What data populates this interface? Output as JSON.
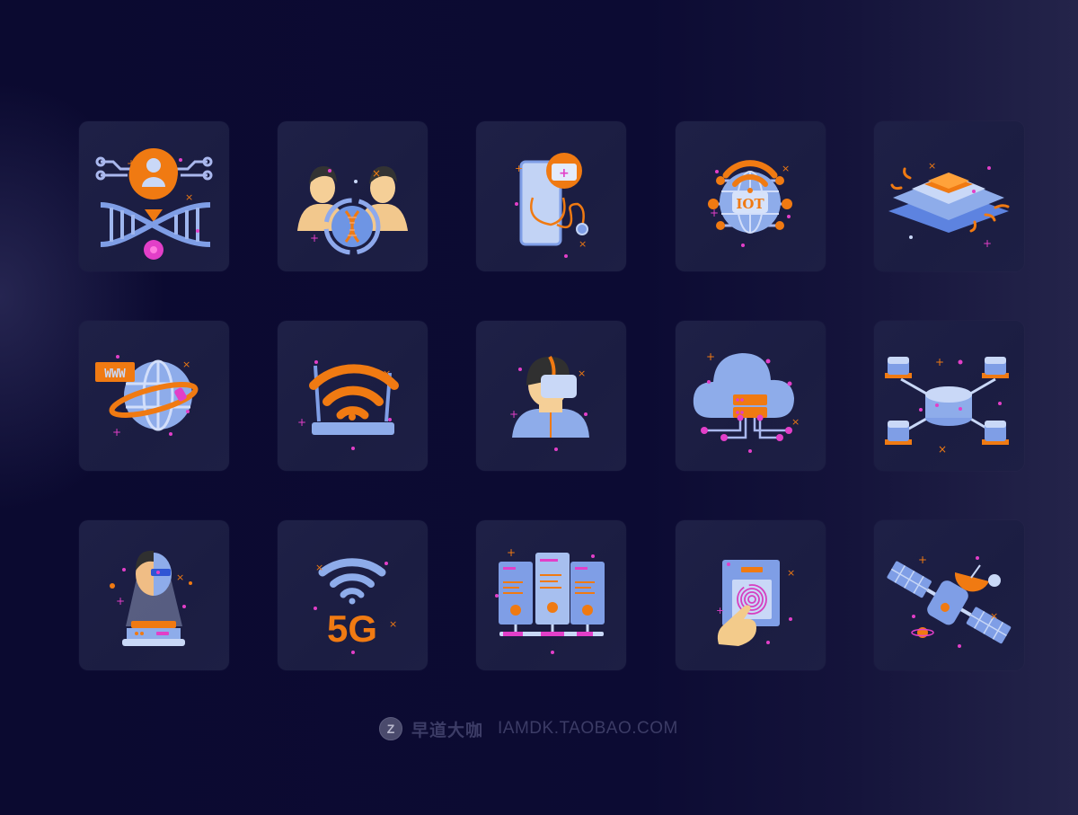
{
  "grid": {
    "tiles": [
      {
        "icon": "dna-user-gear-icon"
      },
      {
        "icon": "human-cloning-dna-icon"
      },
      {
        "icon": "telemedicine-phone-stethoscope-icon"
      },
      {
        "icon": "iot-globe-wifi-icon"
      },
      {
        "icon": "microchip-processor-icon"
      },
      {
        "icon": "www-globe-orbit-icon"
      },
      {
        "icon": "wifi-router-icon"
      },
      {
        "icon": "vr-headset-person-icon"
      },
      {
        "icon": "cloud-server-network-icon"
      },
      {
        "icon": "distributed-database-network-icon"
      },
      {
        "icon": "hologram-cyborg-head-icon"
      },
      {
        "icon": "wifi-5g-icon"
      },
      {
        "icon": "server-rack-network-icon"
      },
      {
        "icon": "fingerprint-scanner-icon"
      },
      {
        "icon": "satellite-dish-icon"
      }
    ],
    "labels": {
      "iot_text": "IOT",
      "www_text": "WWW",
      "fiveg_text": "5G"
    }
  },
  "footer": {
    "logo_letter": "Z",
    "brand": "早道大咖",
    "site": "IAMDK.TAOBAO.COM"
  },
  "colors": {
    "background": "#0b0a30",
    "tile": "#1e2046",
    "orange": "#f07a12",
    "blue": "#7fa3ea",
    "magenta": "#e23fc8"
  }
}
